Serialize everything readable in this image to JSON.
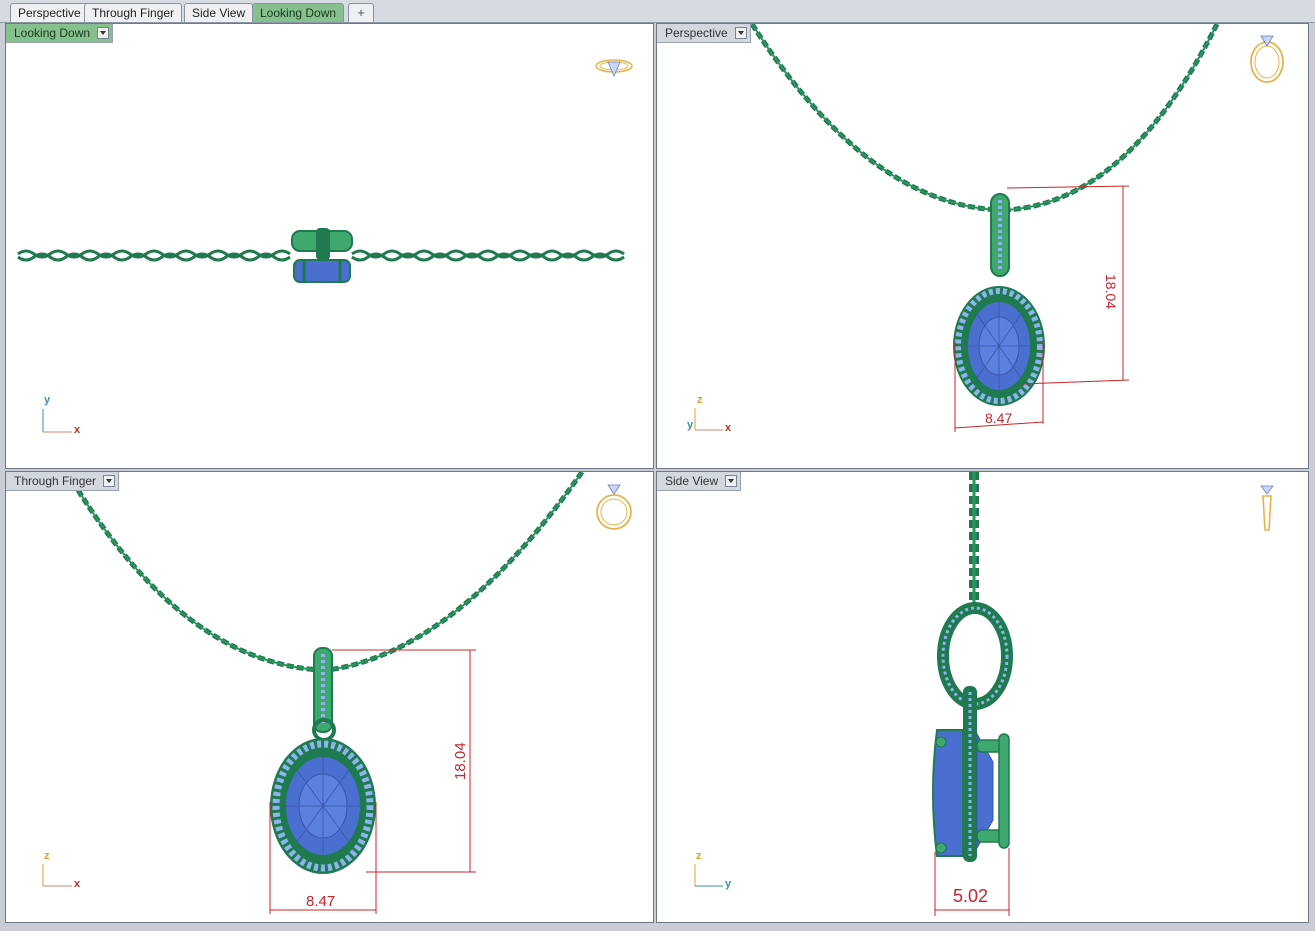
{
  "tabs": [
    {
      "label": "Perspective",
      "active": false
    },
    {
      "label": "Through Finger",
      "active": false
    },
    {
      "label": "Side View",
      "active": false
    },
    {
      "label": "Looking Down",
      "active": true
    }
  ],
  "tab_add_icon": "+",
  "viewports": {
    "looking_down": {
      "label": "Looking Down",
      "active": true,
      "axis_x": "x",
      "axis_y": "y",
      "icon": "ring-top-view-icon"
    },
    "perspective": {
      "label": "Perspective",
      "active": false,
      "axis_x": "x",
      "axis_y": "y",
      "axis_z": "z",
      "icon": "ring-perspective-icon",
      "dim_height": "18.04",
      "dim_width": "8.47"
    },
    "through_finger": {
      "label": "Through Finger",
      "active": false,
      "axis_x": "x",
      "axis_z": "z",
      "icon": "ring-front-icon",
      "dim_height": "18.04",
      "dim_width": "8.47"
    },
    "side_view": {
      "label": "Side View",
      "active": false,
      "axis_y": "y",
      "axis_z": "z",
      "icon": "ring-side-icon",
      "dim_depth": "5.02"
    }
  },
  "colors": {
    "metal": "#1f7a4f",
    "metal_light": "#3fa86f",
    "gem": "#4a6fd0",
    "pave": "#8db4ee",
    "dimension": "#c8262a",
    "active_label": "#86c08f"
  }
}
